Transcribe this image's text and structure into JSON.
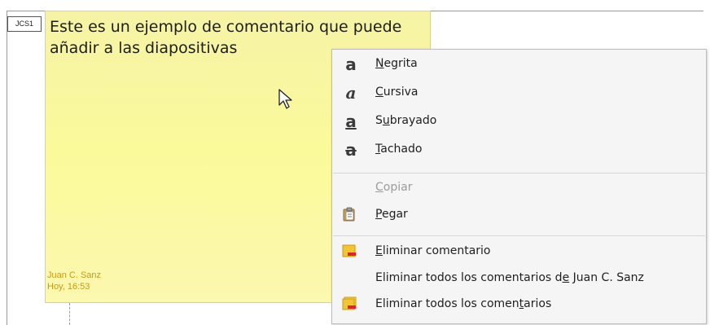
{
  "comment": {
    "author_initials": "JCS1",
    "text": "Este es un ejemplo de comentario que puede añadir a las diapositivas",
    "author": "Juan C. Sanz",
    "time": "Hoy, 16:53"
  },
  "menu": {
    "bold": {
      "pre": "",
      "key": "N",
      "post": "egrita",
      "icon": "bold-a-icon"
    },
    "italic": {
      "pre": "",
      "key": "C",
      "post": "ursiva",
      "icon": "italic-a-icon"
    },
    "underline": {
      "pre": "S",
      "key": "u",
      "post": "brayado",
      "icon": "underline-a-icon"
    },
    "strike": {
      "pre": "",
      "key": "T",
      "post": "achado",
      "icon": "strikethrough-a-icon"
    },
    "copy": {
      "pre": "",
      "key": "C",
      "post": "opiar"
    },
    "paste": {
      "pre": "",
      "key": "P",
      "post": "egar",
      "icon": "clipboard-icon"
    },
    "delete_comment": {
      "pre": "",
      "key": "E",
      "post": "liminar comentario",
      "icon": "delete-comment-icon"
    },
    "delete_author": {
      "pre": "Eliminar todos los comentarios d",
      "key": "e",
      "post": " Juan C. Sanz"
    },
    "delete_all": {
      "pre": "Eliminar todos los comen",
      "key": "t",
      "post": "arios",
      "icon": "delete-all-comments-icon"
    }
  },
  "colors": {
    "note_background": "#fbfa9a",
    "author_text": "#c59a18",
    "menu_background": "#f5f5f5",
    "delete_icon_red": "#d9262b"
  }
}
